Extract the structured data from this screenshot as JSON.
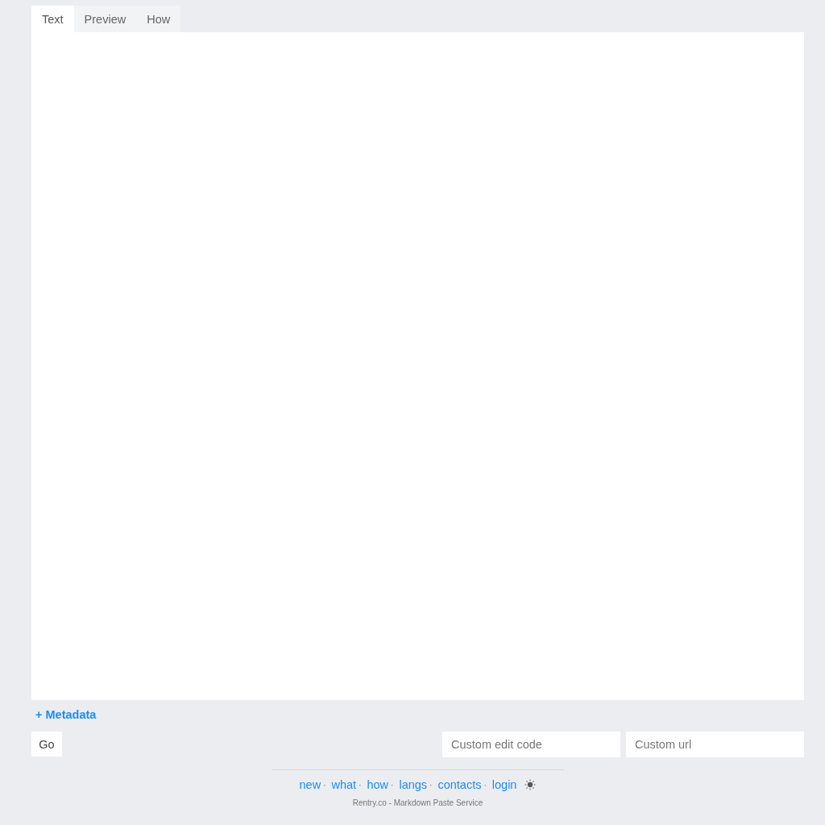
{
  "tabs": [
    {
      "label": "Text",
      "selected": true
    },
    {
      "label": "Preview",
      "selected": false
    },
    {
      "label": "How",
      "selected": false
    }
  ],
  "metadata_toggle": {
    "label": "+ Metadata"
  },
  "actions": {
    "submit": "Go",
    "fields": [
      {
        "placeholder": "Custom edit code"
      },
      {
        "placeholder": "Custom url"
      }
    ]
  },
  "footer": {
    "links": [
      {
        "label": "new",
        "separator": "·"
      },
      {
        "label": "what",
        "separator": "·"
      },
      {
        "label": "how",
        "separator": "·"
      },
      {
        "label": "langs",
        "separator": "·"
      },
      {
        "label": "contacts",
        "separator": "·"
      },
      {
        "label": "login"
      }
    ],
    "credit": "Rentry.co - Markdown Paste Service"
  }
}
